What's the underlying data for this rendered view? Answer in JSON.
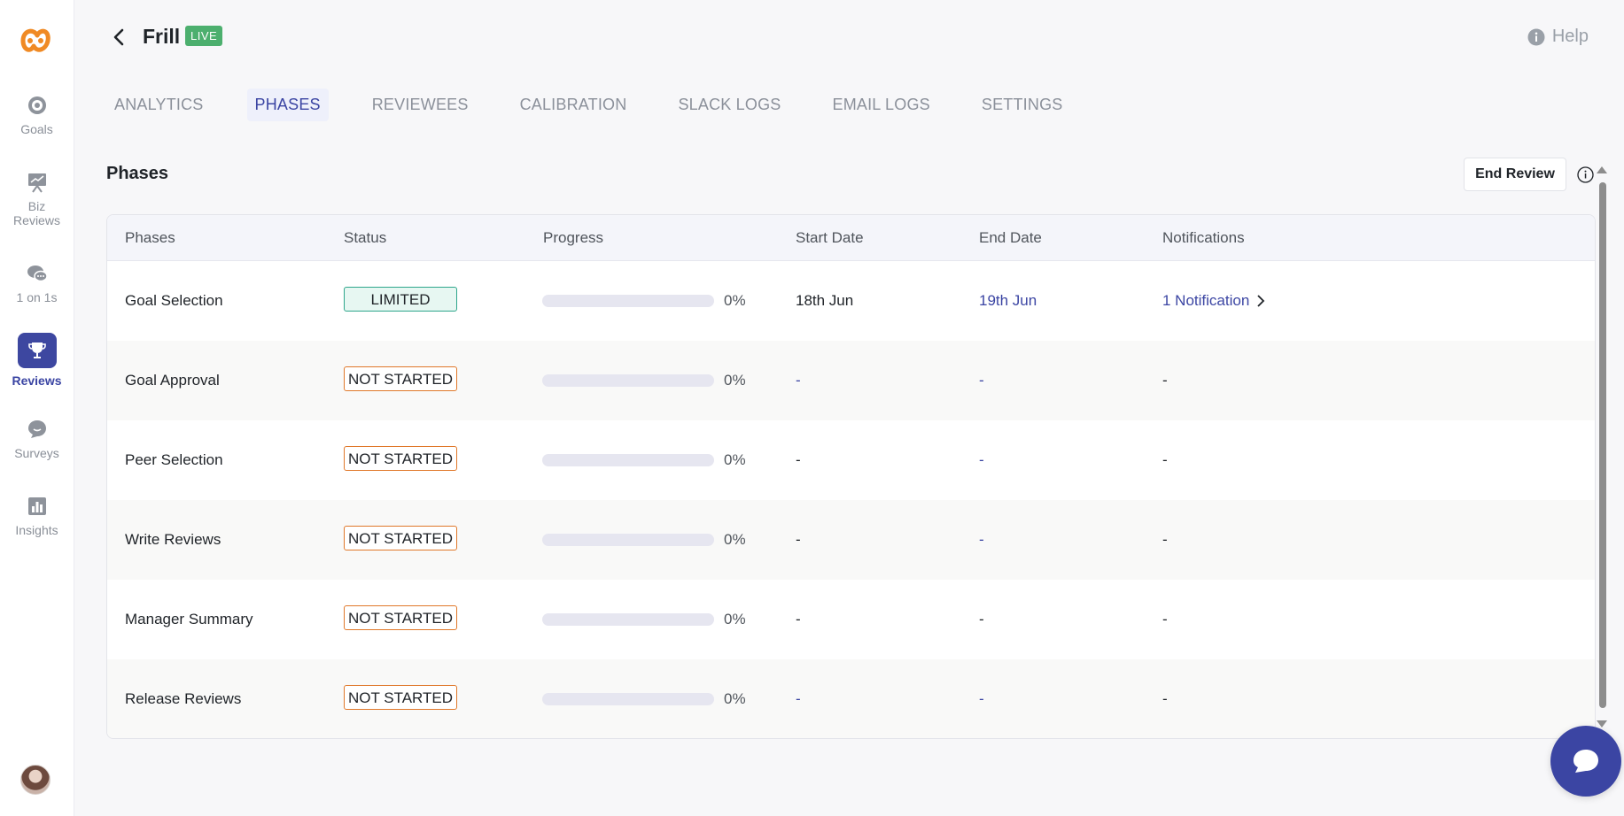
{
  "app": {
    "title": "Frill",
    "badge": "LIVE"
  },
  "help": {
    "label": "Help"
  },
  "sidebar": {
    "items": [
      {
        "label": "Goals",
        "icon": "target-icon"
      },
      {
        "label": "Biz\nReviews",
        "icon": "presentation-icon"
      },
      {
        "label": "1 on 1s",
        "icon": "chat-bubbles-icon"
      },
      {
        "label": "Reviews",
        "icon": "trophy-icon",
        "active": true
      },
      {
        "label": "Surveys",
        "icon": "survey-bubble-icon"
      },
      {
        "label": "Insights",
        "icon": "bar-chart-icon"
      }
    ]
  },
  "tabs": [
    {
      "label": "ANALYTICS"
    },
    {
      "label": "PHASES",
      "active": true
    },
    {
      "label": "REVIEWEES"
    },
    {
      "label": "CALIBRATION"
    },
    {
      "label": "SLACK LOGS"
    },
    {
      "label": "EMAIL LOGS"
    },
    {
      "label": "SETTINGS"
    }
  ],
  "section": {
    "title": "Phases",
    "end_review_label": "End Review"
  },
  "table": {
    "headers": {
      "phases": "Phases",
      "status": "Status",
      "progress": "Progress",
      "start_date": "Start Date",
      "end_date": "End Date",
      "notifications": "Notifications"
    },
    "rows": [
      {
        "phase": "Goal Selection",
        "status": "LIMITED",
        "progress": 0,
        "progress_label": "0%",
        "start_date": "18th Jun",
        "end_date": "19th Jun",
        "notifications": "1 Notification"
      },
      {
        "phase": "Goal Approval",
        "status": "NOT STARTED",
        "progress": 0,
        "progress_label": "0%",
        "start_date": "-",
        "end_date": "-",
        "notifications": "-"
      },
      {
        "phase": "Peer Selection",
        "status": "NOT STARTED",
        "progress": 0,
        "progress_label": "0%",
        "start_date": "-",
        "end_date": "-",
        "notifications": "-"
      },
      {
        "phase": "Write Reviews",
        "status": "NOT STARTED",
        "progress": 0,
        "progress_label": "0%",
        "start_date": "-",
        "end_date": "-",
        "notifications": "-"
      },
      {
        "phase": "Manager Summary",
        "status": "NOT STARTED",
        "progress": 0,
        "progress_label": "0%",
        "start_date": "-",
        "end_date": "-",
        "notifications": "-"
      },
      {
        "phase": "Release Reviews",
        "status": "NOT STARTED",
        "progress": 0,
        "progress_label": "0%",
        "start_date": "-",
        "end_date": "-",
        "notifications": "-"
      }
    ]
  },
  "colors": {
    "accent": "#3b45a3",
    "live_green": "#4caf6e",
    "limited_border": "#2ea68b",
    "not_started_border": "#e0782a",
    "logo_orange": "#f08a24"
  }
}
